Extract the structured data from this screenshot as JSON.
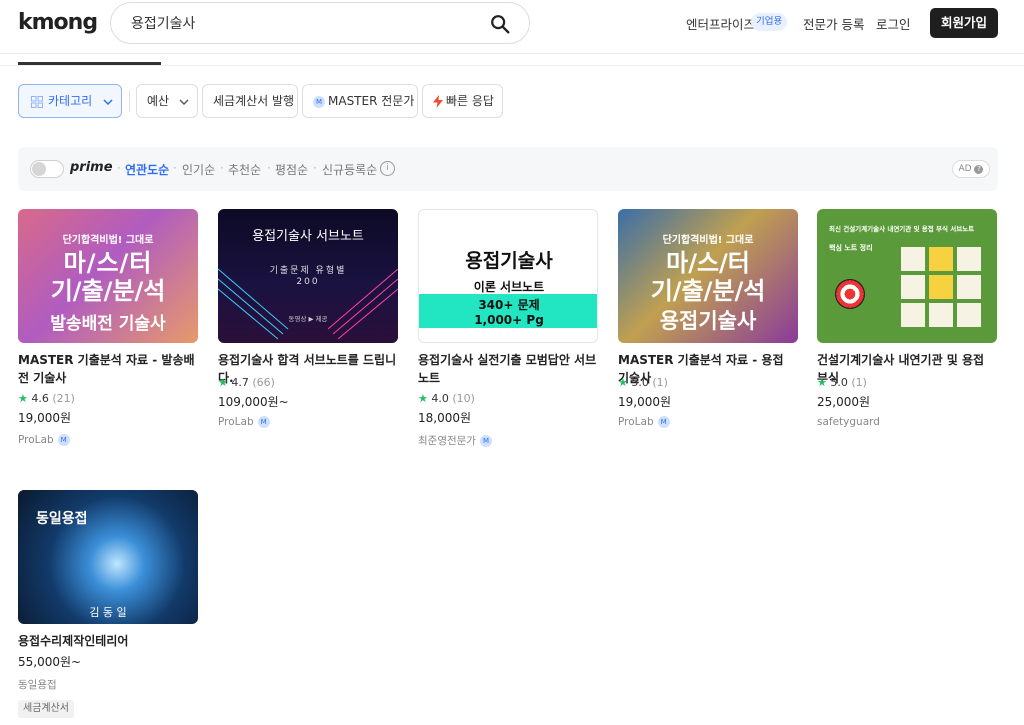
{
  "header": {
    "logo": "kmong",
    "search_value": "용접기술사",
    "nav_enterprise": "엔터프라이즈",
    "nav_enterprise_badge": "기업용",
    "nav_expert": "전문가 등록",
    "nav_login": "로그인",
    "signup": "회원가입"
  },
  "filters": {
    "category": "카테고리",
    "budget": "예산",
    "tax_invoice": "세금계산서 발행",
    "master": "MASTER 전문가",
    "fast_reply": "빠른 응답"
  },
  "sortbar": {
    "prime": "prime",
    "options": [
      "연관도순",
      "인기순",
      "추천순",
      "평점순",
      "신규등록순"
    ],
    "active": "연관도순",
    "ad": "AD"
  },
  "cards": [
    {
      "title": "MASTER 기출분석 자료 - 발송배전 기술사",
      "rating": "4.6",
      "reviews": "(21)",
      "price": "19,000원",
      "seller": "ProLab",
      "seller_badge": "M",
      "thumb_top": "단기합격비법! 그대로",
      "thumb_mid1": "마/스/터",
      "thumb_mid2": "기/출/분/석",
      "thumb_bottom": "발송배전 기술사"
    },
    {
      "title": "용접기술사 합격 서브노트를 드립니다.",
      "rating": "4.7",
      "reviews": "(66)",
      "price": "109,000원~",
      "seller": "ProLab",
      "seller_badge": "M",
      "thumb_top": "용접기술사 서브노트",
      "thumb_mid1": "기출문제 유형별",
      "thumb_mid2": "200",
      "thumb_bottom": "동영상 ▶ 제공"
    },
    {
      "title": "용접기술사 실전기출 모범답안 서브노트",
      "rating": "4.0",
      "reviews": "(10)",
      "price": "18,000원",
      "seller": "최준영전문가",
      "seller_badge": "M",
      "thumb_top": "용접기술사",
      "thumb_mid1": "이론 서브노트",
      "thumb_mid2": "340+ 문제",
      "thumb_bottom": "1,000+ Pg"
    },
    {
      "title": "MASTER 기출분석 자료 - 용접 기술사",
      "rating": "5.0",
      "reviews": "(1)",
      "price": "19,000원",
      "seller": "ProLab",
      "seller_badge": "M",
      "thumb_top": "단기합격비법! 그대로",
      "thumb_mid1": "마/스/터",
      "thumb_mid2": "기/출/분/석",
      "thumb_bottom": "용접기술사"
    },
    {
      "title": "건설기계기술사 내연기관 및 용접 부식",
      "rating": "5.0",
      "reviews": "(1)",
      "price": "25,000원",
      "seller": "safetyguard",
      "thumb_top": "최신 건설기계기술사 내연기관 및 용접 부식 서브노트",
      "thumb_mid1": "핵심 노트 정리"
    },
    {
      "title": "용접수리제작인테리어",
      "price": "55,000원~",
      "seller": "동일용접",
      "tag": "세금계산서",
      "thumb_top": "동일용접",
      "thumb_bottom": "김 동 일"
    }
  ]
}
